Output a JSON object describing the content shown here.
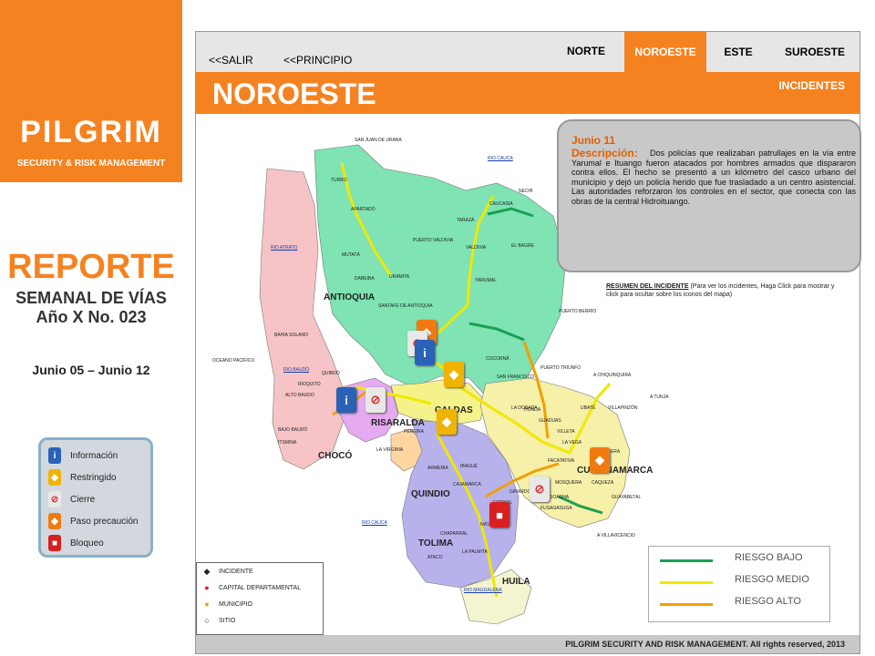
{
  "brand": {
    "name": "PILGRIM",
    "tagline": "SECURITY & RISK MANAGEMENT",
    "bg_color": "#f58220"
  },
  "report": {
    "title": "REPORTE",
    "subtitle": "SEMANAL DE VÍAS",
    "issue": "Año X No. 023",
    "dates": "Junio 05 – Junio 12"
  },
  "icon_legend": [
    {
      "label": "Información",
      "icon": "info-icon",
      "color": "#2a62b8"
    },
    {
      "label": "Restringido",
      "icon": "restricted-icon",
      "color": "#f0b400"
    },
    {
      "label": "Cierre",
      "icon": "closure-icon",
      "color": "#e8e8e8"
    },
    {
      "label": "Paso precaución",
      "icon": "caution-icon",
      "color": "#f07a10"
    },
    {
      "label": "Bloqueo",
      "icon": "block-icon",
      "color": "#d82020"
    }
  ],
  "nav": {
    "exit": "<<SALIR",
    "home": "<<PRINCIPIO",
    "region_tabs": [
      {
        "label": "NORTE",
        "active": false
      },
      {
        "label": "NOROESTE",
        "active": true
      },
      {
        "label": "ESTE",
        "active": false
      },
      {
        "label": "SUROESTE",
        "active": false
      }
    ]
  },
  "region_title": "NOROESTE",
  "incidents_link": "INCIDENTES",
  "popup": {
    "date": "Junio 11",
    "desc_label": "Descripción:",
    "text": "Dos policías que realizaban patrullajes en la vía entre Yarumal e Ituango fueron atacados por hombres armados que dispararon contra ellos. El hecho se presentó a un kilómetro del casco urbano del municipio y dejó un policía herido que fue trasladado a un centro asistencial. Las autoridades reforzaron los controles en el sector, que conecta con las obras de la central Hidroituango."
  },
  "summary": {
    "title": "RESUMEN DEL INCIDENTE",
    "text": "(Para ver los incidentes, Haga Click para mostrar y click para ocultar sobre los iconos del mapa)"
  },
  "departments": [
    {
      "name": "ANTIOQUIA"
    },
    {
      "name": "CHOCÓ"
    },
    {
      "name": "RISARALDA"
    },
    {
      "name": "CALDAS"
    },
    {
      "name": "QUINDIO"
    },
    {
      "name": "TOLIMA"
    },
    {
      "name": "CUNDINAMARCA"
    },
    {
      "name": "HUILA"
    }
  ],
  "places": [
    "SAN JUAN DE URABA",
    "TURBO",
    "APARTADÓ",
    "MUTATÁ",
    "DABEIBA",
    "URAMITA",
    "SANTAFE DE ANTIOQUIA",
    "PUERTO VALDIVIA",
    "VALDIVIA",
    "TARAZÁ",
    "CAUCASIA",
    "NECHÍ",
    "EL BAGRE",
    "YARUMAL",
    "PUERTO BERRIO",
    "PUERTO TRIUNFO",
    "A CHIQUINQUIRA",
    "A TUNJA",
    "BAHIA SOLANO",
    "QUIBDÓ",
    "RIOQUITO",
    "ALTO BAUDO",
    "BAJO BAUDÓ",
    "ITSMINA",
    "LA VIRGINIA",
    "PEREIRA",
    "ARMENIA",
    "IBAGUÉ",
    "CAJAMARCA",
    "GIRARDOT",
    "ESPINAL",
    "NATAGAIMA",
    "CHAPARRAL",
    "ATACO",
    "LA PALMITA",
    "GUADUAS",
    "VILLETA",
    "LA VEGA",
    "FACATATIVA",
    "MOSQUERA",
    "SOACHA",
    "FUSAGASUGA",
    "LA CALERA",
    "CAQUEZA",
    "UBATÉ",
    "VILLAPINZÓN",
    "A VILLAVICENCIO",
    "OCEANO PACIFICO",
    "GUAYABETAL",
    "COCORNÁ",
    "SAN FRANCISCO",
    "LA DORADA",
    "HONDA"
  ],
  "rivers": [
    "RIO CAUCA",
    "RIO ATRATO",
    "RIO BAUDÓ",
    "RIO CAUCA",
    "RIO MAGDALENA"
  ],
  "risk_legend": [
    {
      "label": "RIESGO BAJO",
      "color": "#1aa050"
    },
    {
      "label": "RIESGO MEDIO",
      "color": "#f0e800"
    },
    {
      "label": "RIESGO ALTO",
      "color": "#f0a000"
    }
  ],
  "symbol_legend": [
    {
      "label": "INCIDENTE",
      "icon": "incident-diamond-icon"
    },
    {
      "label": "CAPITAL DEPARTAMENTAL",
      "icon": "capital-dot-icon"
    },
    {
      "label": "MUNICIPIO",
      "icon": "municipality-dot-icon"
    },
    {
      "label": "SITIO",
      "icon": "site-circle-icon"
    }
  ],
  "footer": "PILGRIM SECURITY AND RISK MANAGEMENT. All rights reserved, 2013"
}
